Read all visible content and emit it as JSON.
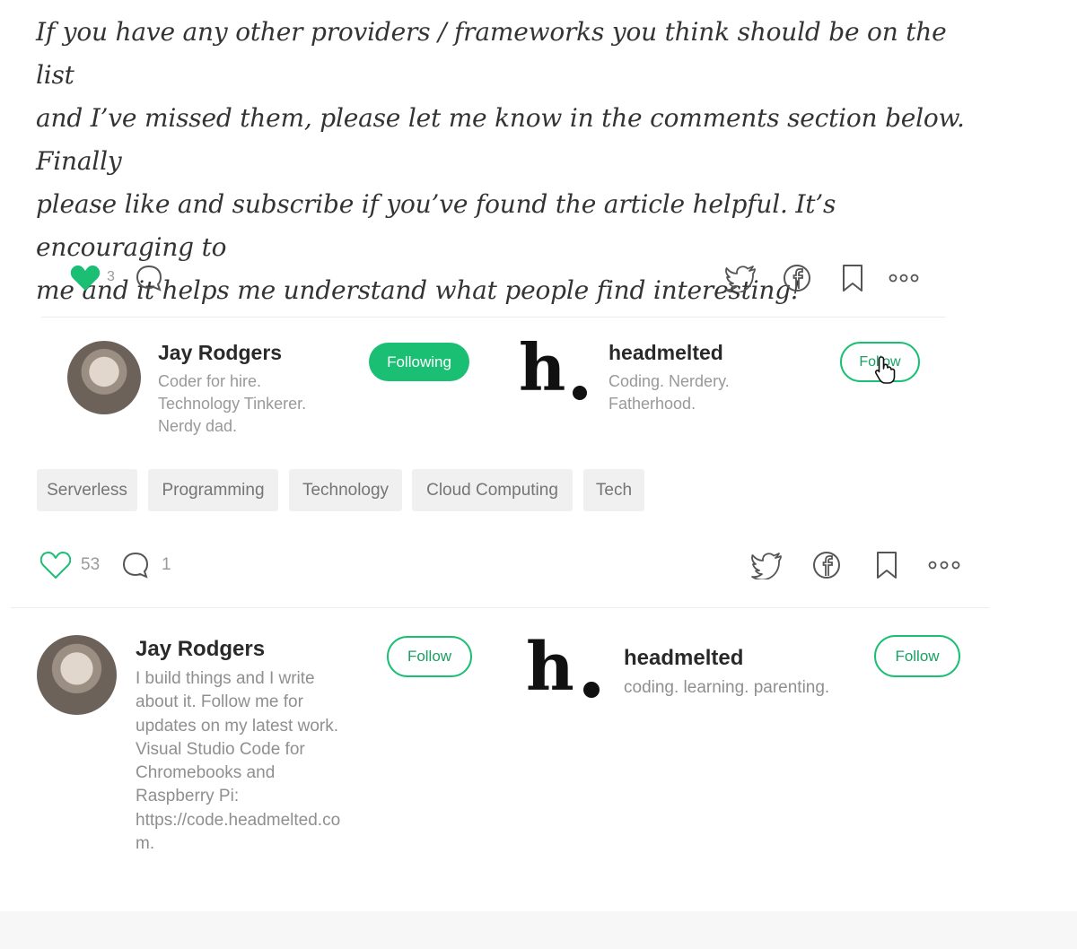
{
  "article": {
    "closing_lines": [
      "If you have any other providers / frameworks you think should be on the list",
      "and I’ve missed them, please let me know in the comments section below. Finally",
      "please like and subscribe if you’ve found the article helpful. It’s encouraging to",
      "me and it helps me understand what people find interesting!"
    ]
  },
  "top_actions": {
    "clap_count": "3",
    "icons": [
      "heart-filled-icon",
      "comment-icon",
      "twitter-icon",
      "facebook-icon",
      "bookmark-icon",
      "more-icon"
    ]
  },
  "top_author": {
    "name": "Jay Rodgers",
    "bio_lines": [
      "Coder for hire.",
      "Technology Tinkerer.",
      "Nerdy dad."
    ],
    "button": "Following"
  },
  "top_publication": {
    "logo_text": "h",
    "name": "headmelted",
    "bio_lines": [
      "Coding. Nerdery.",
      "Fatherhood."
    ],
    "button": "Follow"
  },
  "tags": [
    "Serverless",
    "Programming",
    "Technology",
    "Cloud Computing",
    "Tech"
  ],
  "bottom_actions": {
    "clap_count": "53",
    "comment_count": "1",
    "icons": [
      "heart-outline-icon",
      "comment-icon",
      "twitter-icon",
      "facebook-icon",
      "bookmark-icon",
      "more-icon"
    ]
  },
  "bottom_author": {
    "name": "Jay Rodgers",
    "bio_lines": [
      "I build things and I write",
      "about it. Follow me for",
      "updates on my latest work.",
      "Visual Studio Code for",
      "Chromebooks and",
      "Raspberry Pi:",
      "https://code.headmelted.co",
      "m."
    ],
    "button": "Follow"
  },
  "bottom_publication": {
    "logo_text": "h",
    "name": "headmelted",
    "bio": "coding. learning. parenting.",
    "button": "Follow"
  },
  "colors": {
    "accent": "#1bbf73",
    "muted": "#999999"
  }
}
